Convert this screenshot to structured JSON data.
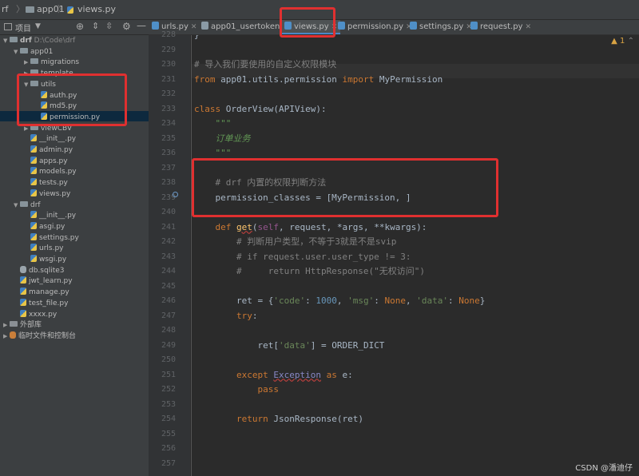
{
  "breadcrumb": [
    "rf",
    "app01",
    "views.py"
  ],
  "project_panel": {
    "title": "项目"
  },
  "tabs": [
    {
      "label": "urls.py",
      "active": false
    },
    {
      "label": "app01_usertoken",
      "active": false
    },
    {
      "label": "views.py",
      "active": true
    },
    {
      "label": "permission.py",
      "active": false
    },
    {
      "label": "settings.py",
      "active": false
    },
    {
      "label": "request.py",
      "active": false
    }
  ],
  "warning_count": "1",
  "tree": [
    {
      "label": "drf",
      "extra": "D:\\Code\\drf",
      "type": "dir",
      "depth": 0,
      "open": true
    },
    {
      "label": "app01",
      "type": "dir",
      "depth": 1,
      "open": true
    },
    {
      "label": "migrations",
      "type": "dir",
      "depth": 2,
      "open": false
    },
    {
      "label": "template",
      "type": "dir",
      "depth": 2,
      "open": false
    },
    {
      "label": "utils",
      "type": "dir",
      "depth": 2,
      "open": true
    },
    {
      "label": "auth.py",
      "type": "py",
      "depth": 3
    },
    {
      "label": "md5.py",
      "type": "py",
      "depth": 3
    },
    {
      "label": "permission.py",
      "type": "py",
      "depth": 3,
      "selected": true
    },
    {
      "label": "viewCBV",
      "type": "dir",
      "depth": 2,
      "open": false
    },
    {
      "label": "__init__.py",
      "type": "py",
      "depth": 2
    },
    {
      "label": "admin.py",
      "type": "py",
      "depth": 2
    },
    {
      "label": "apps.py",
      "type": "py",
      "depth": 2
    },
    {
      "label": "models.py",
      "type": "py",
      "depth": 2
    },
    {
      "label": "tests.py",
      "type": "py",
      "depth": 2
    },
    {
      "label": "views.py",
      "type": "py",
      "depth": 2
    },
    {
      "label": "drf",
      "type": "dir",
      "depth": 1,
      "open": true
    },
    {
      "label": "__init__.py",
      "type": "py",
      "depth": 2
    },
    {
      "label": "asgi.py",
      "type": "py",
      "depth": 2
    },
    {
      "label": "settings.py",
      "type": "py",
      "depth": 2
    },
    {
      "label": "urls.py",
      "type": "py",
      "depth": 2
    },
    {
      "label": "wsgi.py",
      "type": "py",
      "depth": 2
    },
    {
      "label": "db.sqlite3",
      "type": "db",
      "depth": 1
    },
    {
      "label": "jwt_learn.py",
      "type": "py",
      "depth": 1
    },
    {
      "label": "manage.py",
      "type": "py",
      "depth": 1
    },
    {
      "label": "test_file.py",
      "type": "py",
      "depth": 1
    },
    {
      "label": "xxxx.py",
      "type": "py",
      "depth": 1
    },
    {
      "label": "外部库",
      "type": "lib",
      "depth": 0,
      "open": false
    },
    {
      "label": "临时文件和控制台",
      "type": "scratch",
      "depth": 0,
      "open": false
    }
  ],
  "line_numbers": [
    "228",
    "229",
    "230",
    "231",
    "232",
    "233",
    "234",
    "235",
    "236",
    "237",
    "238",
    "239",
    "240",
    "241",
    "242",
    "243",
    "244",
    "245",
    "246",
    "247",
    "248",
    "249",
    "250",
    "251",
    "252",
    "253",
    "254",
    "255",
    "256",
    "257"
  ],
  "code_lines": [
    [
      [
        "t",
        "}"
      ]
    ],
    [],
    [
      [
        "cm",
        "# 导入我们要使用的自定义权限模块"
      ]
    ],
    [
      [
        "kw",
        "from"
      ],
      [
        "t",
        " app01.utils.permission "
      ],
      [
        "kw",
        "import"
      ],
      [
        "t",
        " MyPermission"
      ]
    ],
    [],
    [
      [
        "kw",
        "class"
      ],
      [
        "t",
        " OrderView(APIView):"
      ]
    ],
    [
      [
        "doc",
        "    \"\"\""
      ]
    ],
    [
      [
        "doc",
        "    订单业务"
      ]
    ],
    [
      [
        "doc",
        "    \"\"\""
      ]
    ],
    [],
    [
      [
        "cm",
        "    # drf 内置的权限判断方法"
      ]
    ],
    [
      [
        "t",
        "    permission_classes = [MyPermission, ]"
      ]
    ],
    [],
    [
      [
        "t",
        "    "
      ],
      [
        "kw",
        "def"
      ],
      [
        "t",
        " "
      ],
      [
        "fn",
        "get"
      ],
      [
        "t",
        "("
      ],
      [
        "sf",
        "self"
      ],
      [
        "t",
        ", request, *args, **kwargs):"
      ]
    ],
    [
      [
        "cm",
        "        # 判断用户类型，不等于3就是不是svip"
      ]
    ],
    [
      [
        "cm",
        "        # if request.user.user_type != 3:"
      ]
    ],
    [
      [
        "cm",
        "        #     return HttpResponse(\"无权访问\")"
      ]
    ],
    [],
    [
      [
        "t",
        "        ret = {"
      ],
      [
        "str",
        "'code'"
      ],
      [
        "t",
        ": "
      ],
      [
        "num",
        "1000"
      ],
      [
        "t",
        ", "
      ],
      [
        "str",
        "'msg'"
      ],
      [
        "t",
        ": "
      ],
      [
        "kw",
        "None"
      ],
      [
        "t",
        ", "
      ],
      [
        "str",
        "'data'"
      ],
      [
        "t",
        ": "
      ],
      [
        "kw",
        "None"
      ],
      [
        "t",
        "}"
      ]
    ],
    [
      [
        "t",
        "        "
      ],
      [
        "kw",
        "try"
      ],
      [
        "t",
        ":"
      ]
    ],
    [],
    [
      [
        "t",
        "            ret["
      ],
      [
        "str",
        "'data'"
      ],
      [
        "t",
        "] = ORDER_DICT"
      ]
    ],
    [],
    [
      [
        "t",
        "        "
      ],
      [
        "kw",
        "except"
      ],
      [
        "t",
        " "
      ],
      [
        "bi",
        "Exception"
      ],
      [
        "t",
        " "
      ],
      [
        "kw",
        "as"
      ],
      [
        "t",
        " e:"
      ]
    ],
    [
      [
        "t",
        "            "
      ],
      [
        "kw",
        "pass"
      ]
    ],
    [],
    [
      [
        "t",
        "        "
      ],
      [
        "kw",
        "return"
      ],
      [
        "t",
        " JsonResponse(ret)"
      ]
    ],
    [],
    [],
    []
  ],
  "watermark": "CSDN @潘迪仔"
}
